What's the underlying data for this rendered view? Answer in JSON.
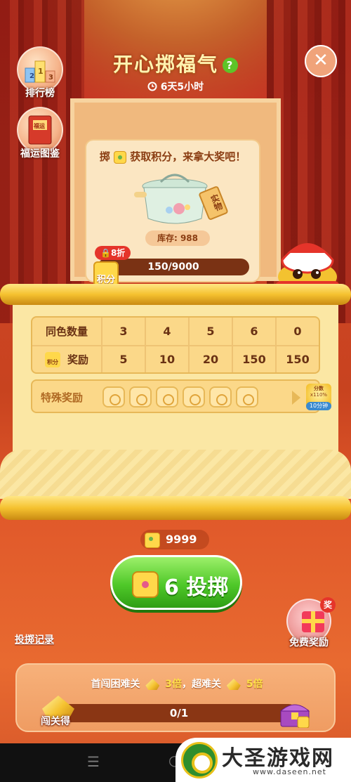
{
  "header": {
    "title": "开心掷福气",
    "help_symbol": "?",
    "timer": "6天5小时",
    "close_symbol": "✕"
  },
  "side_buttons": {
    "leaderboard": {
      "label": "排行榜",
      "icon_text": "123"
    },
    "collection": {
      "label": "福运图鉴",
      "icon_text": "福运"
    }
  },
  "prize": {
    "title_prefix": "掷",
    "title_suffix": "获取积分，来拿大奖吧！",
    "real_tag": "实物",
    "stock": "库存: 988",
    "discount": "8折",
    "points_label": "积分",
    "progress_text": "150/9000",
    "progress": 0.0167
  },
  "reward_table": {
    "row1": {
      "header": "同色数量",
      "cells": [
        "3",
        "4",
        "5",
        "6",
        "0"
      ]
    },
    "row2": {
      "header": "奖励",
      "header_icon": "积分",
      "cells": [
        "5",
        "10",
        "20",
        "150",
        "150"
      ]
    },
    "special_label": "特殊奖励",
    "bonus_top": "分数",
    "bonus_mult": "x110%",
    "bonus_time": "10分钟"
  },
  "dice": {
    "count": "9999",
    "roll_label": "6 投掷"
  },
  "links": {
    "roll_log": "投掷记录",
    "free_reward": "免费奖励",
    "free_badge": "奖"
  },
  "challenge": {
    "text_a": "首闯困难关",
    "mult_a": "3倍",
    "text_b": "，超难关",
    "mult_b": "5倍",
    "progress_text": "0/1",
    "label": "闯关得"
  },
  "watermark": {
    "title": "大圣游戏网",
    "url": "www.daseen.net"
  },
  "system_nav": {
    "menu": "☰",
    "home": "○"
  },
  "colors": {
    "roll_button": "#4fc829",
    "accent_gold": "#f5c230",
    "background_red": "#c8431f"
  }
}
